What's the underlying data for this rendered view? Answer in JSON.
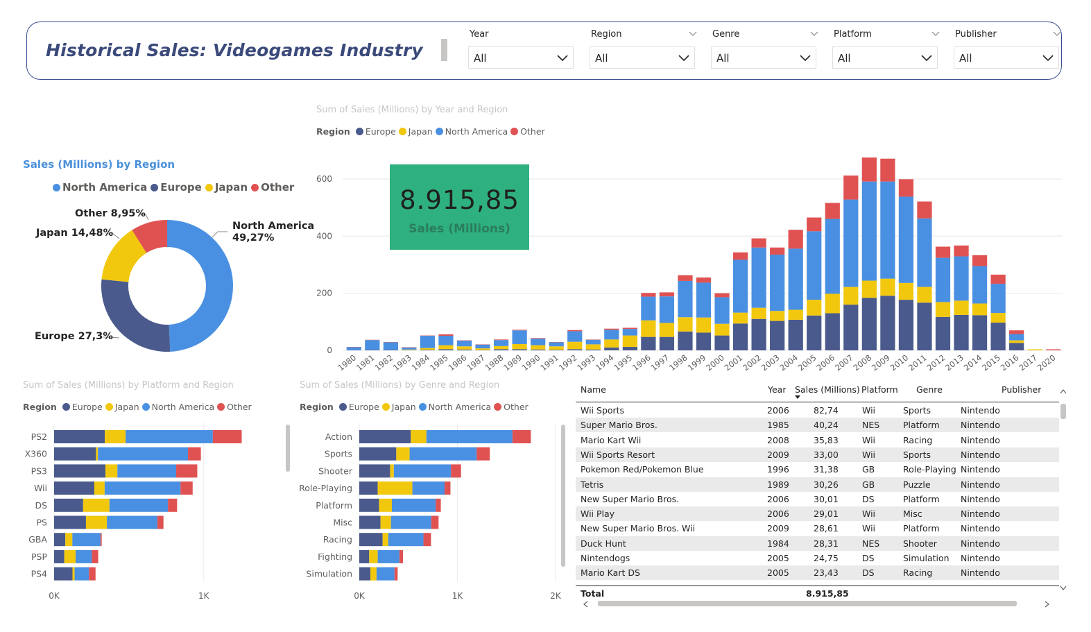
{
  "header": {
    "title": "Historical Sales: Videogames Industry",
    "slicers": [
      {
        "label": "Year",
        "value": "All"
      },
      {
        "label": "Region",
        "value": "All"
      },
      {
        "label": "Genre",
        "value": "All"
      },
      {
        "label": "Platform",
        "value": "All"
      },
      {
        "label": "Publisher",
        "value": "All"
      }
    ]
  },
  "colors": {
    "europe": "#4a5a8c",
    "japan": "#f2c80f",
    "north_america": "#4a90e2",
    "other": "#e05252",
    "kpi_bg": "#2fb07f"
  },
  "kpi": {
    "value": "8.915,85",
    "label": "Sales (Millions)"
  },
  "donut": {
    "title": "Sales (Millions) by Region",
    "legend": [
      "North America",
      "Europe",
      "Japan",
      "Other"
    ],
    "labels": {
      "north_america_name": "North America",
      "north_america_pct": "49,27%",
      "europe": "Europe 27,3%",
      "japan": "Japan 14,48%",
      "other": "Other 8,95%"
    }
  },
  "legend_items": {
    "title": "Region",
    "europe": "Europe",
    "japan": "Japan",
    "north_america": "North America",
    "other": "Other"
  },
  "table": {
    "columns": {
      "name": "Name",
      "year": "Year",
      "sales": "Sales (Millions)",
      "platform": "Platform",
      "genre": "Genre",
      "publisher": "Publisher"
    },
    "rows": [
      {
        "name": "Wii Sports",
        "year": "2006",
        "sales": "82,74",
        "platform": "Wii",
        "genre": "Sports",
        "publisher": "Nintendo"
      },
      {
        "name": "Super Mario Bros.",
        "year": "1985",
        "sales": "40,24",
        "platform": "NES",
        "genre": "Platform",
        "publisher": "Nintendo"
      },
      {
        "name": "Mario Kart Wii",
        "year": "2008",
        "sales": "35,83",
        "platform": "Wii",
        "genre": "Racing",
        "publisher": "Nintendo"
      },
      {
        "name": "Wii Sports Resort",
        "year": "2009",
        "sales": "33,00",
        "platform": "Wii",
        "genre": "Sports",
        "publisher": "Nintendo"
      },
      {
        "name": "Pokemon Red/Pokemon Blue",
        "year": "1996",
        "sales": "31,38",
        "platform": "GB",
        "genre": "Role-Playing",
        "publisher": "Nintendo"
      },
      {
        "name": "Tetris",
        "year": "1989",
        "sales": "30,26",
        "platform": "GB",
        "genre": "Puzzle",
        "publisher": "Nintendo"
      },
      {
        "name": "New Super Mario Bros.",
        "year": "2006",
        "sales": "30,01",
        "platform": "DS",
        "genre": "Platform",
        "publisher": "Nintendo"
      },
      {
        "name": "Wii Play",
        "year": "2006",
        "sales": "29,01",
        "platform": "Wii",
        "genre": "Misc",
        "publisher": "Nintendo"
      },
      {
        "name": "New Super Mario Bros. Wii",
        "year": "2009",
        "sales": "28,61",
        "platform": "Wii",
        "genre": "Platform",
        "publisher": "Nintendo"
      },
      {
        "name": "Duck Hunt",
        "year": "1984",
        "sales": "28,31",
        "platform": "NES",
        "genre": "Shooter",
        "publisher": "Nintendo"
      },
      {
        "name": "Nintendogs",
        "year": "2005",
        "sales": "24,75",
        "platform": "DS",
        "genre": "Simulation",
        "publisher": "Nintendo"
      },
      {
        "name": "Mario Kart DS",
        "year": "2005",
        "sales": "23,43",
        "platform": "DS",
        "genre": "Racing",
        "publisher": "Nintendo"
      }
    ],
    "total_label": "Total",
    "total_value": "8.915,85"
  },
  "chart_data": [
    {
      "type": "bar",
      "title": "Sum of Sales (Millions) by Year and Region",
      "stacked": true,
      "categories": [
        "1980",
        "1981",
        "1982",
        "1983",
        "1984",
        "1985",
        "1986",
        "1987",
        "1988",
        "1989",
        "1990",
        "1991",
        "1992",
        "1993",
        "1994",
        "1995",
        "1996",
        "1997",
        "1998",
        "1999",
        "2000",
        "2001",
        "2002",
        "2003",
        "2004",
        "2005",
        "2006",
        "2007",
        "2008",
        "2009",
        "2010",
        "2011",
        "2012",
        "2013",
        "2014",
        "2015",
        "2016",
        "2017",
        "2020"
      ],
      "series": [
        {
          "name": "Europe",
          "values": [
            1,
            2,
            2,
            1,
            2,
            4,
            3,
            1,
            4,
            4,
            3,
            2,
            4,
            3,
            10,
            12,
            47,
            47,
            66,
            62,
            52,
            94,
            110,
            103,
            107,
            122,
            130,
            160,
            184,
            191,
            177,
            167,
            117,
            124,
            123,
            97,
            26,
            0,
            0
          ]
        },
        {
          "name": "Japan",
          "values": [
            0,
            0,
            0,
            2,
            6,
            14,
            11,
            6,
            11,
            18,
            15,
            12,
            26,
            18,
            28,
            40,
            58,
            49,
            50,
            53,
            41,
            38,
            39,
            35,
            35,
            55,
            68,
            62,
            60,
            60,
            59,
            55,
            52,
            50,
            41,
            34,
            9,
            1,
            0
          ]
        },
        {
          "name": "North America",
          "values": [
            10,
            34,
            26,
            7,
            43,
            33,
            20,
            13,
            21,
            48,
            23,
            14,
            37,
            16,
            34,
            23,
            83,
            93,
            127,
            122,
            93,
            185,
            211,
            197,
            214,
            240,
            262,
            306,
            347,
            340,
            302,
            240,
            155,
            155,
            131,
            102,
            22,
            0,
            0
          ]
        },
        {
          "name": "Other",
          "values": [
            1,
            1,
            1,
            1,
            1,
            5,
            1,
            1,
            2,
            2,
            2,
            1,
            4,
            1,
            4,
            4,
            13,
            14,
            20,
            18,
            14,
            26,
            32,
            25,
            66,
            48,
            56,
            84,
            84,
            80,
            61,
            59,
            39,
            38,
            38,
            32,
            13,
            0,
            0
          ]
        }
      ],
      "xlabel": "",
      "ylabel": "",
      "ylim": [
        0,
        680
      ],
      "yticks": [
        0,
        200,
        400,
        600
      ]
    },
    {
      "type": "bar",
      "orientation": "horizontal",
      "title": "Sum of Sales (Millions) by Platform and Region",
      "stacked": true,
      "categories": [
        "PS2",
        "X360",
        "PS3",
        "Wii",
        "DS",
        "PS",
        "GBA",
        "PSP",
        "PS4"
      ],
      "series": [
        {
          "name": "Europe",
          "values": [
            339,
            280,
            343,
            269,
            194,
            213,
            75,
            68,
            123
          ]
        },
        {
          "name": "Japan",
          "values": [
            139,
            13,
            80,
            69,
            176,
            140,
            47,
            76,
            14
          ]
        },
        {
          "name": "North America",
          "values": [
            583,
            602,
            393,
            507,
            391,
            337,
            188,
            108,
            96
          ]
        },
        {
          "name": "Other",
          "values": [
            193,
            86,
            141,
            81,
            61,
            41,
            8,
            43,
            44
          ]
        }
      ],
      "xticks": [
        "0K",
        "1K"
      ],
      "xlim": [
        0,
        1400
      ]
    },
    {
      "type": "bar",
      "orientation": "horizontal",
      "title": "Sum of Sales (Millions) by Genre and Region",
      "stacked": true,
      "categories": [
        "Action",
        "Sports",
        "Shooter",
        "Role-Playing",
        "Platform",
        "Misc",
        "Racing",
        "Fighting",
        "Simulation"
      ],
      "series": [
        {
          "name": "Europe",
          "values": [
            525,
            377,
            314,
            188,
            201,
            216,
            238,
            101,
            113
          ]
        },
        {
          "name": "Japan",
          "values": [
            159,
            136,
            38,
            353,
            131,
            107,
            57,
            87,
            63
          ]
        },
        {
          "name": "North America",
          "values": [
            877,
            683,
            582,
            328,
            447,
            410,
            359,
            221,
            183
          ]
        },
        {
          "name": "Other",
          "values": [
            187,
            134,
            103,
            60,
            52,
            75,
            77,
            36,
            32
          ]
        }
      ],
      "xticks": [
        "0K",
        "1K",
        "2K"
      ],
      "xlim": [
        0,
        2000
      ]
    },
    {
      "type": "pie",
      "title": "Sales (Millions) by Region",
      "donut": true,
      "categories": [
        "North America",
        "Europe",
        "Japan",
        "Other"
      ],
      "values": [
        49.27,
        27.3,
        14.48,
        8.95
      ]
    }
  ]
}
